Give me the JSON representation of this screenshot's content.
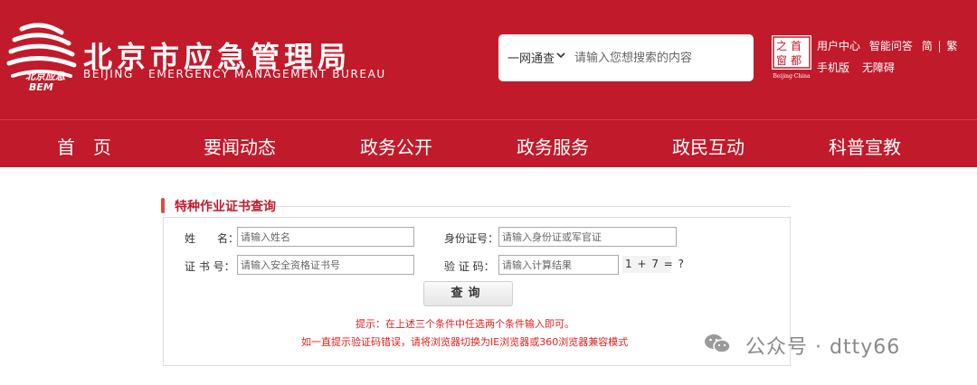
{
  "header": {
    "logo_text": "北京应急",
    "logo_abbrev": "BEM",
    "title_cn": "北京市应急管理局",
    "title_en": "BEIJING   EMERGENCY MANAGEMENT BUREAU",
    "search": {
      "scope": "一网通查",
      "placeholder": "请输入您想搜索的内容"
    },
    "seal": {
      "chars": [
        "首",
        "都",
        "之",
        "窗"
      ],
      "caption": "Beijing·China"
    },
    "links_row1": [
      "用户中心",
      "智能问答",
      "简",
      "|",
      "繁"
    ],
    "links_row2": [
      "手机版",
      "无障碍"
    ]
  },
  "nav": {
    "items": [
      "首　页",
      "要闻动态",
      "政务公开",
      "政务服务",
      "政民互动",
      "科普宣教"
    ]
  },
  "section": {
    "title": "特种作业证书查询"
  },
  "form": {
    "name_label": "姓　　名：",
    "name_placeholder": "请输入姓名",
    "id_label": "身份证号：",
    "id_placeholder": "请输入身份证或军官证",
    "cert_label": "证 书 号：",
    "cert_placeholder": "请输入安全资格证书号",
    "captcha_label": "验 证 码：",
    "captcha_placeholder": "请输入计算结果",
    "captcha_question": "1 + 7 = ?",
    "query_button": "查询",
    "hint1": "提示：在上述三个条件中任选两个条件输入即可。",
    "hint2": "如一直提示验证码错误，请将浏览器切换为IE浏览器或360浏览器兼容模式"
  },
  "watermark": {
    "text": "公众号 · dtty66"
  },
  "colors": {
    "brand_red": "#c11a2b",
    "hint_red": "#e02020"
  }
}
